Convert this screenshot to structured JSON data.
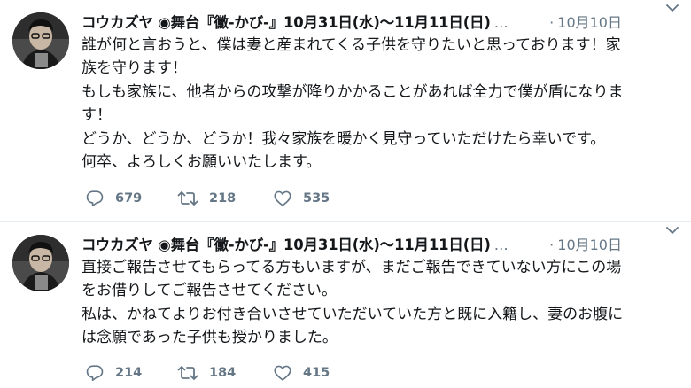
{
  "tweets": [
    {
      "display_name": "コウカズヤ ◉舞台『黴-かび-』10月31日(水)〜11月11日(日)",
      "handle": "…",
      "date": "10月10日",
      "lines": [
        "誰が何と言おうと、僕は妻と産まれてくる子供を守りたいと思っております！家",
        "族を守ります！",
        "もしも家族に、他者からの攻撃が降りかかることがあれば全力で僕が盾になりま",
        "す！",
        "どうか、どうか、どうか！我々家族を暖かく見守っていただけたら幸いです。",
        "何卒、よろしくお願いいたします。"
      ],
      "replies": "679",
      "retweets": "218",
      "likes": "535"
    },
    {
      "display_name": "コウカズヤ ◉舞台『黴-かび-』10月31日(水)〜11月11日(日)",
      "handle": "…",
      "date": "10月10日",
      "lines": [
        "直接ご報告させてもらってる方もいますが、まだご報告できていない方にこの場",
        "をお借りしてご報告させてください。",
        "私は、かねてよりお付き合いさせていただいていた方と既に入籍し、妻のお腹に",
        "は念願であった子供も授かりました。"
      ],
      "replies": "214",
      "retweets": "184",
      "likes": "415"
    }
  ],
  "colors": {
    "text": "#14171a",
    "secondary": "#657786",
    "divider": "#e6ecf0"
  },
  "icons": {
    "reply": "reply-icon",
    "retweet": "retweet-icon",
    "like": "like-icon",
    "menu": "chevron-down-icon"
  }
}
